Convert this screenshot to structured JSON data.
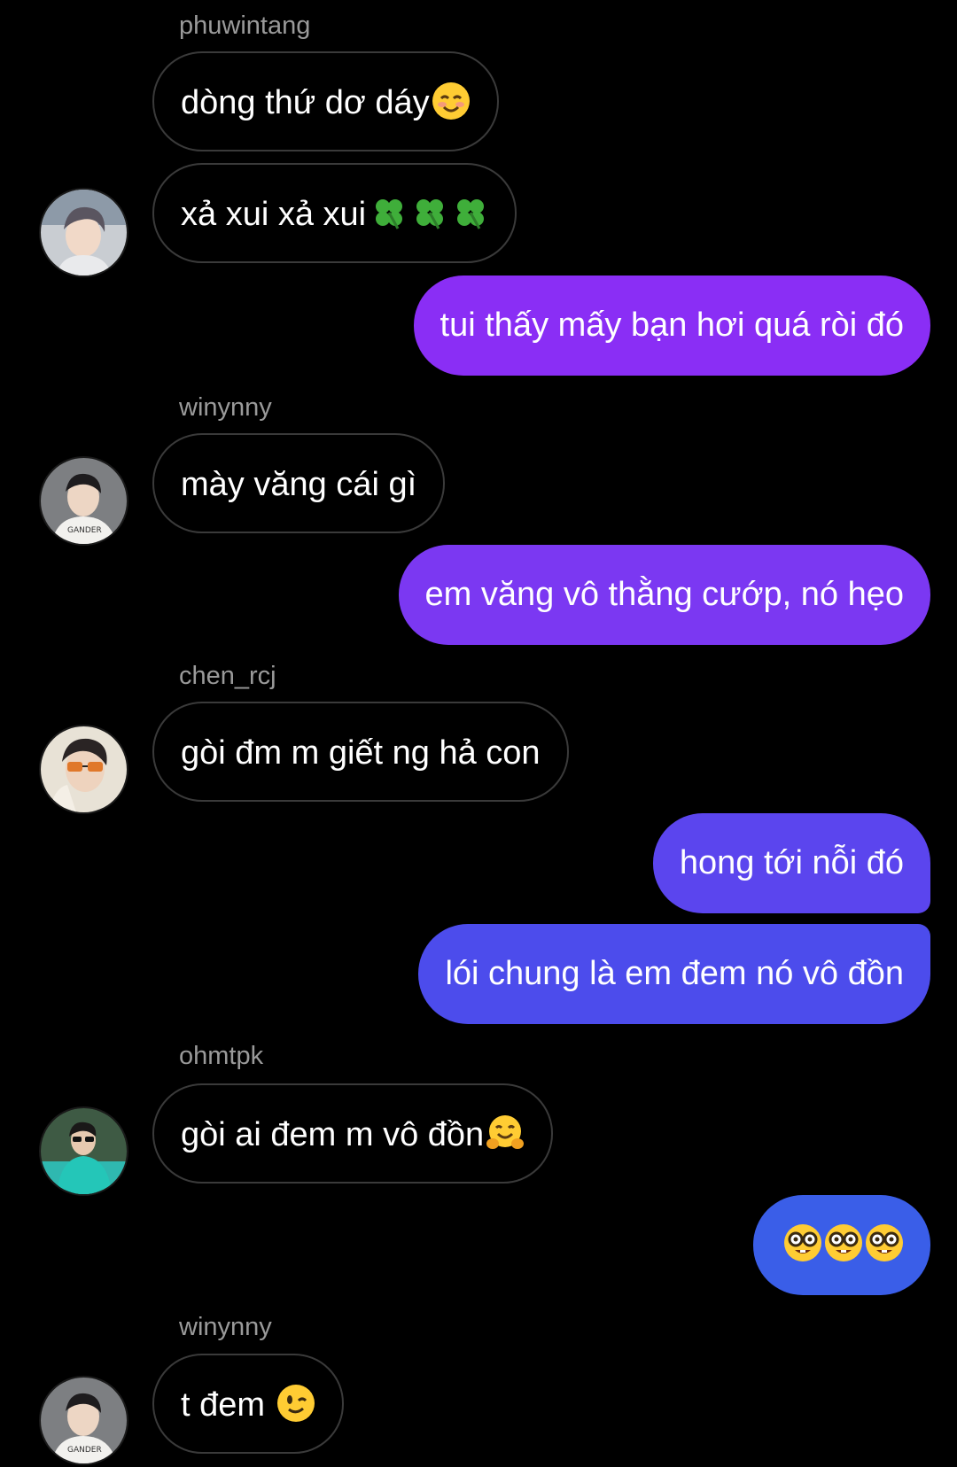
{
  "messages": [
    {
      "sender": "phuwintang",
      "text": "dòng thứ dơ dáy",
      "emoji": "smiling-blush"
    },
    {
      "text": "xả xui xả xui",
      "emoji": "four-leaf-clover x3"
    },
    {
      "text": "tui thấy mấy bạn hơi quá ròi đó"
    },
    {
      "sender": "winynny",
      "text": "mày văng cái gì"
    },
    {
      "text": "em văng vô thằng cướp, nó hẹo"
    },
    {
      "sender": "chen_rcj",
      "text": "gòi đm m giết ng hả con"
    },
    {
      "text": "hong tới nỗi đó"
    },
    {
      "text": "lói chung là em đem nó vô đồn"
    },
    {
      "sender": "ohmtpk",
      "text": "gòi ai đem m vô đồn",
      "emoji": "hugging-face"
    },
    {
      "text": "",
      "emoji": "nerd-face x3"
    },
    {
      "sender": "winynny",
      "text": "t đem ",
      "emoji": "winking-face"
    }
  ],
  "colors": {
    "background": "#000000",
    "sender_name": "#9a9a9a",
    "received_border": "#3a3a3a",
    "sent_violet": "#8a2ef5",
    "sent_purple": "#7b38f2",
    "sent_indigo": "#5b45ee",
    "sent_blue": "#3a5ee8"
  }
}
